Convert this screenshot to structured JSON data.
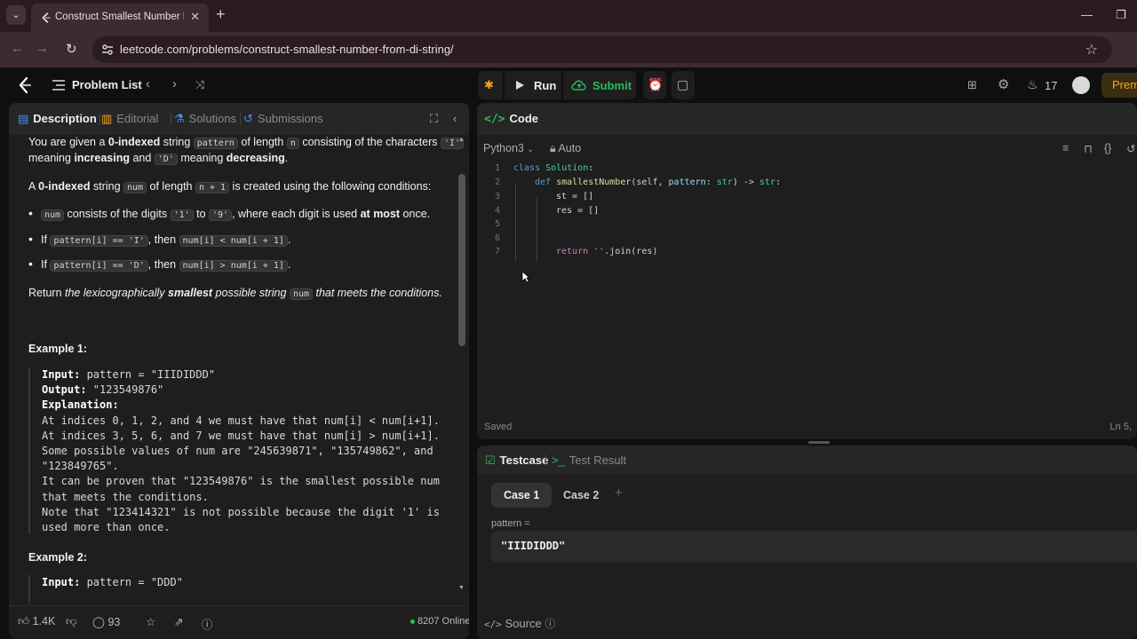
{
  "browser": {
    "tab_title": "Construct Smallest Number Fro",
    "url": "leetcode.com/problems/construct-smallest-number-from-di-string/",
    "minimize": "—",
    "maximize": "❐"
  },
  "nav": {
    "problem_list": "Problem List",
    "run": "Run",
    "submit": "Submit",
    "streak": "17",
    "premium": "Prem"
  },
  "desc_tabs": {
    "description": "Description",
    "editorial": "Editorial",
    "solutions": "Solutions",
    "submissions": "Submissions"
  },
  "desc": {
    "l1a": "You are given a ",
    "l1b": "0-indexed",
    "l1c": " string ",
    "l1d": "pattern",
    "l1e": " of length ",
    "l1f": "n",
    "l1g": " consisting of the characters ",
    "l1h": "'I'",
    "l2a": "meaning ",
    "l2b": "increasing",
    "l2c": " and ",
    "l2d": "'D'",
    "l2e": " meaning ",
    "l2f": "decreasing",
    "l2g": ".",
    "l3a": "A ",
    "l3b": "0-indexed",
    "l3c": " string ",
    "l3d": "num",
    "l3e": " of length ",
    "l3f": "n + 1",
    "l3g": " is created using the following conditions:",
    "b1a": "num",
    "b1b": " consists of the digits ",
    "b1c": "'1'",
    "b1d": " to ",
    "b1e": "'9'",
    "b1f": ", where each digit is used ",
    "b1g": "at most",
    "b1h": " once.",
    "b2a": "If ",
    "b2b": "pattern[i] == 'I'",
    "b2c": ", then ",
    "b2d": "num[i] < num[i + 1]",
    "b2e": ".",
    "b3a": "If ",
    "b3b": "pattern[i] == 'D'",
    "b3c": ", then ",
    "b3d": "num[i] > num[i + 1]",
    "b3e": ".",
    "r1": "Return ",
    "r2": "the lexicographically ",
    "r3": "smallest",
    "r4": " possible string ",
    "r5": "num",
    "r6": " that meets the conditions."
  },
  "example1": {
    "title": "Example 1:",
    "input_label": "Input:",
    "input_val": " pattern = \"IIIDIDDD\"",
    "output_label": "Output:",
    "output_val": " \"123549876\"",
    "expl_label": "Explanation:",
    "lines": [
      "At indices 0, 1, 2, and 4 we must have that num[i] < num[i+1].",
      "At indices 3, 5, 6, and 7 we must have that num[i] > num[i+1].",
      "Some possible values of num are \"245639871\", \"135749862\", and",
      "\"123849765\".",
      "It can be proven that \"123549876\" is the smallest possible num",
      "that meets the conditions.",
      "Note that \"123414321\" is not possible because the digit '1' is",
      "used more than once."
    ]
  },
  "example2": {
    "title": "Example 2:",
    "input_label": "Input:",
    "input_val": " pattern = \"DDD\""
  },
  "footer": {
    "likes": "1.4K",
    "comments": "93",
    "online": "8207 Online"
  },
  "code": {
    "tab": "Code",
    "lang": "Python3",
    "auto": "Auto",
    "saved": "Saved",
    "position": "Ln 5,",
    "lines": [
      {
        "n": "1"
      },
      {
        "n": "2"
      },
      {
        "n": "3"
      },
      {
        "n": "4"
      },
      {
        "n": "5"
      },
      {
        "n": "6"
      },
      {
        "n": "7"
      }
    ],
    "l1": {
      "kw": "class",
      "name": " Solution",
      "rest": ":"
    },
    "l2": {
      "kw": "def",
      "name": " smallestNumber",
      "p1": "(self, ",
      "p2": "pattern",
      "p3": ": ",
      "p4": "str",
      "p5": ") -> ",
      "p6": "str",
      "p7": ":"
    },
    "l3": "st = []",
    "l4": "res = []",
    "l7": {
      "kw": "return",
      "s": " ''",
      "rest": ".join(res)"
    }
  },
  "testcase": {
    "tab": "Testcase",
    "result_tab": "Test Result",
    "case1": "Case 1",
    "case2": "Case 2",
    "add": "+",
    "param_label": "pattern =",
    "param_value": "\"IIIDIDDD\"",
    "source": "Source"
  }
}
